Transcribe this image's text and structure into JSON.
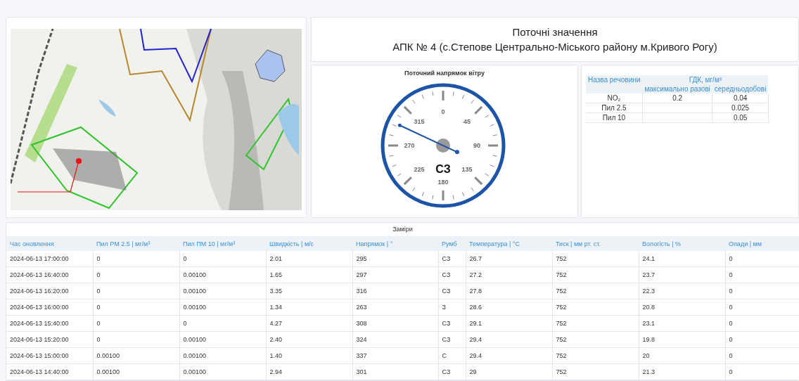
{
  "header": {
    "title": "Поточні значення",
    "subtitle": "АПК № 4 (с.Степове Центрально-Міського району м.Кривого Рогу)"
  },
  "wind": {
    "title": "Поточний напрямок вітру",
    "labels": [
      "0",
      "45",
      "90",
      "135",
      "180",
      "225",
      "270",
      "315"
    ],
    "rumb": "СЗ"
  },
  "limits": {
    "group_header": "ГДК, мг/м³",
    "columns": [
      "Назва речовини",
      "максимально разові",
      "середньодобові"
    ],
    "rows": [
      [
        "NO₂",
        "0.2",
        "0.04"
      ],
      [
        "Пил 2.5",
        "",
        "0.025"
      ],
      [
        "Пил 10",
        "",
        "0.05"
      ]
    ]
  },
  "measurements": {
    "title": "Заміри",
    "columns": [
      "Час оновлення",
      "Пил PM 2.5 | мг/м³",
      "Пил ПМ 10 | мг/м³",
      "Швидкість | м/с",
      "Напрямок | °",
      "Румб",
      "Температура | °C",
      "Тиск | мм рт. ст.",
      "Вологість | %",
      "Опади | мм"
    ],
    "rows": [
      [
        "2024-06-13 17:00:00",
        "0",
        "0",
        "2.01",
        "295",
        "СЗ",
        "26.7",
        "752",
        "24.1",
        "0"
      ],
      [
        "2024-06-13 16:40:00",
        "0",
        "0.00100",
        "1.65",
        "297",
        "СЗ",
        "27.2",
        "752",
        "23.7",
        "0"
      ],
      [
        "2024-06-13 16:20:00",
        "0",
        "0.00100",
        "3.35",
        "316",
        "СЗ",
        "27.8",
        "752",
        "22.3",
        "0"
      ],
      [
        "2024-06-13 16:00:00",
        "0",
        "0.00100",
        "1.34",
        "263",
        "З",
        "28.6",
        "752",
        "20.8",
        "0"
      ],
      [
        "2024-06-13 15:40:00",
        "0",
        "0",
        "4.27",
        "308",
        "СЗ",
        "29.1",
        "752",
        "23.1",
        "0"
      ],
      [
        "2024-06-13 15:20:00",
        "0",
        "0.00100",
        "2.40",
        "324",
        "СЗ",
        "29.4",
        "752",
        "19.8",
        "0"
      ],
      [
        "2024-06-13 15:00:00",
        "0.00100",
        "0.00100",
        "1.40",
        "337",
        "С",
        "29.4",
        "752",
        "20",
        "0"
      ],
      [
        "2024-06-13 14:40:00",
        "0.00100",
        "0.00100",
        "2.94",
        "301",
        "СЗ",
        "29",
        "752",
        "21.3",
        "0"
      ]
    ]
  }
}
